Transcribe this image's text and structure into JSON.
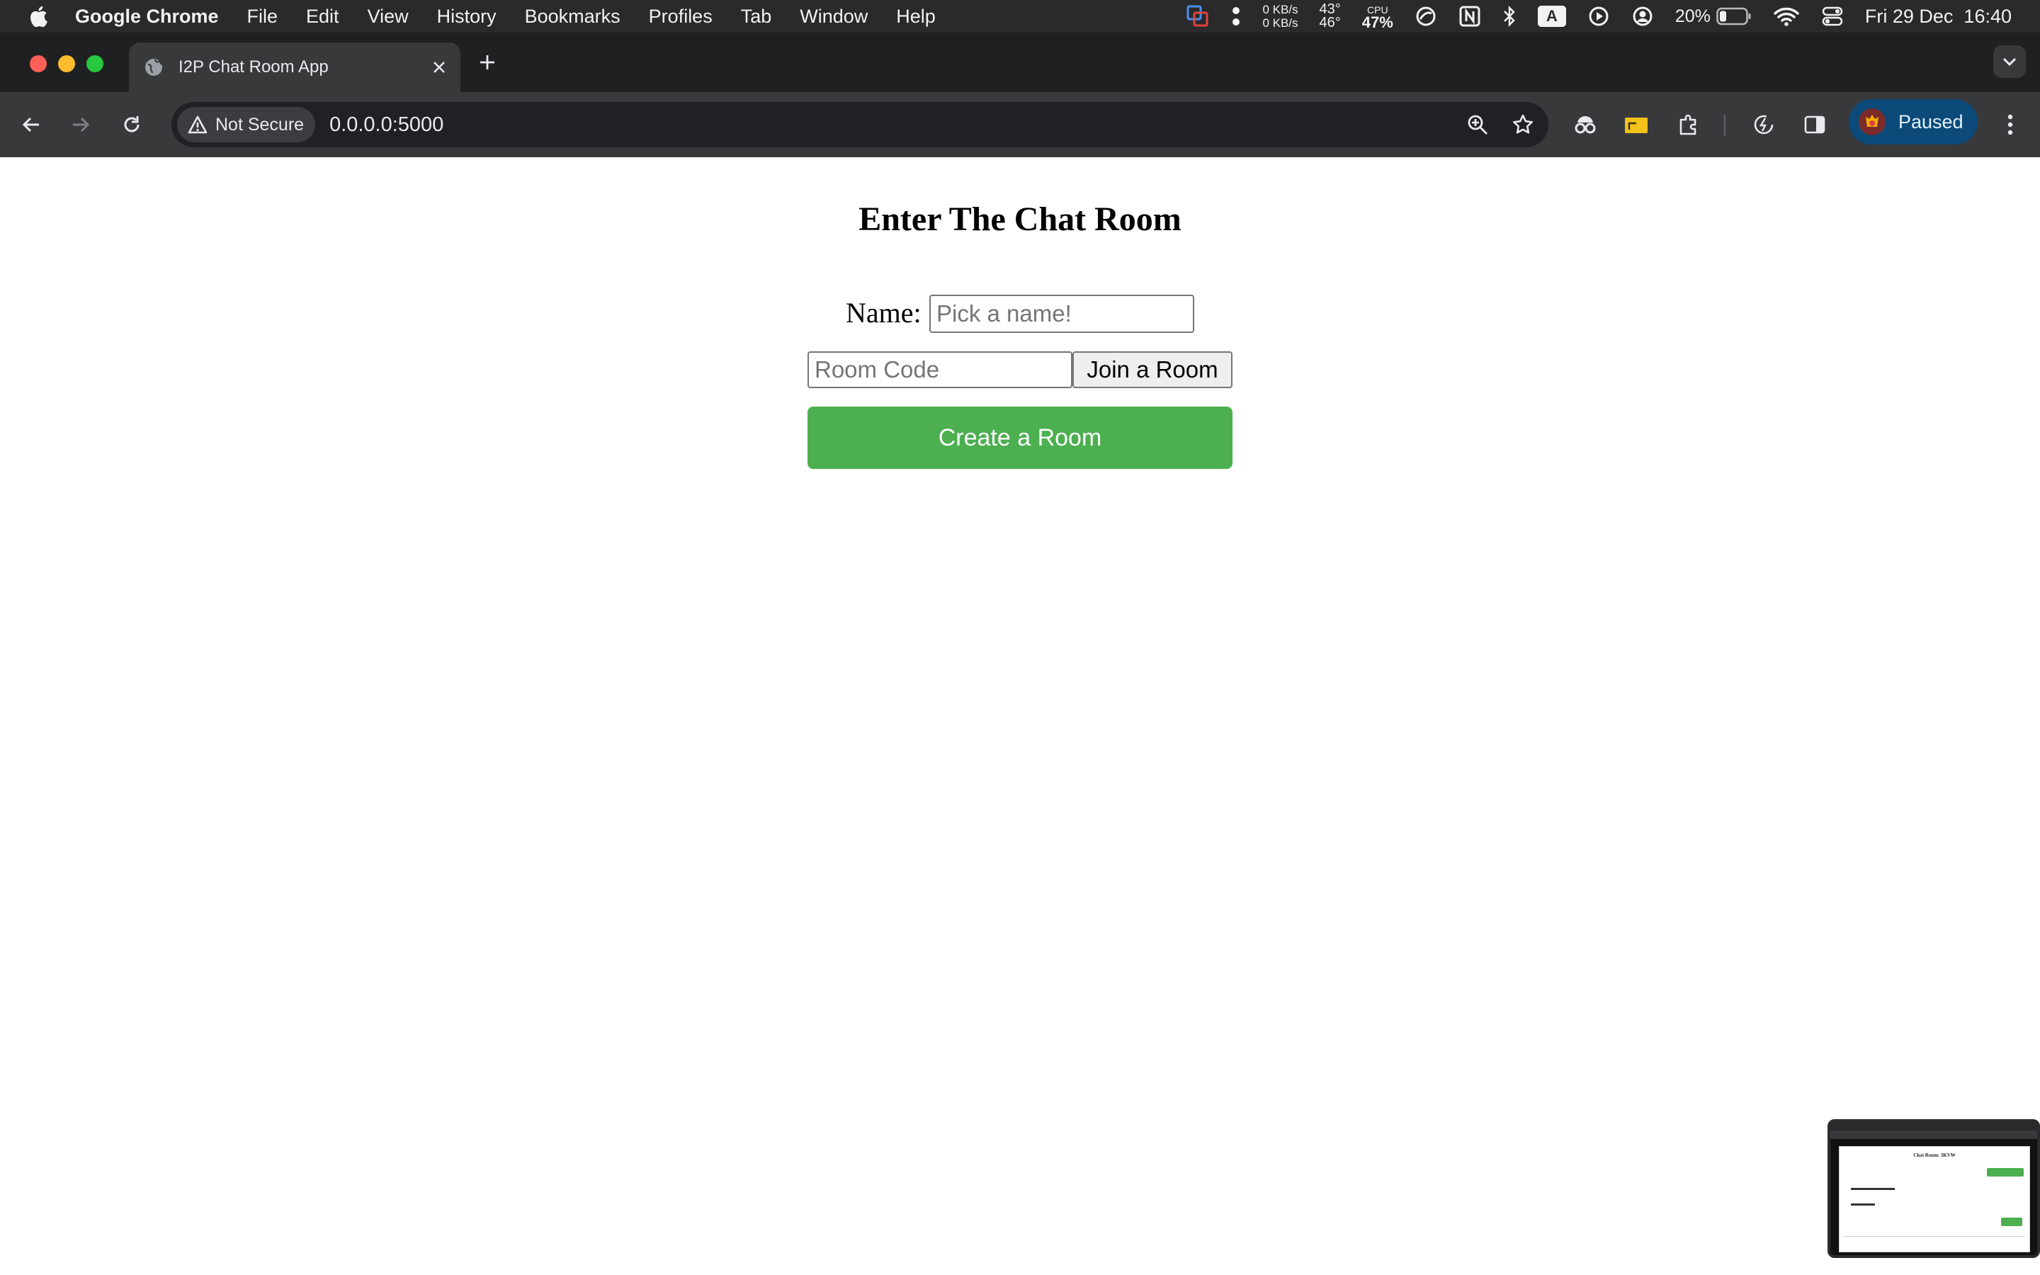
{
  "menubar": {
    "app_name": "Google Chrome",
    "items": [
      "File",
      "Edit",
      "View",
      "History",
      "Bookmarks",
      "Profiles",
      "Tab",
      "Window",
      "Help"
    ],
    "status": {
      "net_up": "0 KB/s",
      "net_down": "0 KB/s",
      "temp_top": "43°",
      "temp_bottom": "46°",
      "cpu_label": "CPU",
      "cpu_value": "47%",
      "keyboard_input": "A",
      "battery": "20%",
      "datetime": "Fri 29 Dec  16:40"
    }
  },
  "browser": {
    "tab_title": "I2P Chat Room App",
    "security_label": "Not Secure",
    "url": "0.0.0.0:5000",
    "profile_status": "Paused"
  },
  "page": {
    "heading": "Enter The Chat Room",
    "name_label": "Name:",
    "name_placeholder": "Pick a name!",
    "room_code_placeholder": "Room Code",
    "join_button": "Join a Room",
    "create_button": "Create a Room"
  },
  "thumbnail": {
    "title": "Chat Room: 3KVW"
  },
  "colors": {
    "create_button_bg": "#4caf50",
    "profile_chip_bg": "#0b4a79"
  }
}
